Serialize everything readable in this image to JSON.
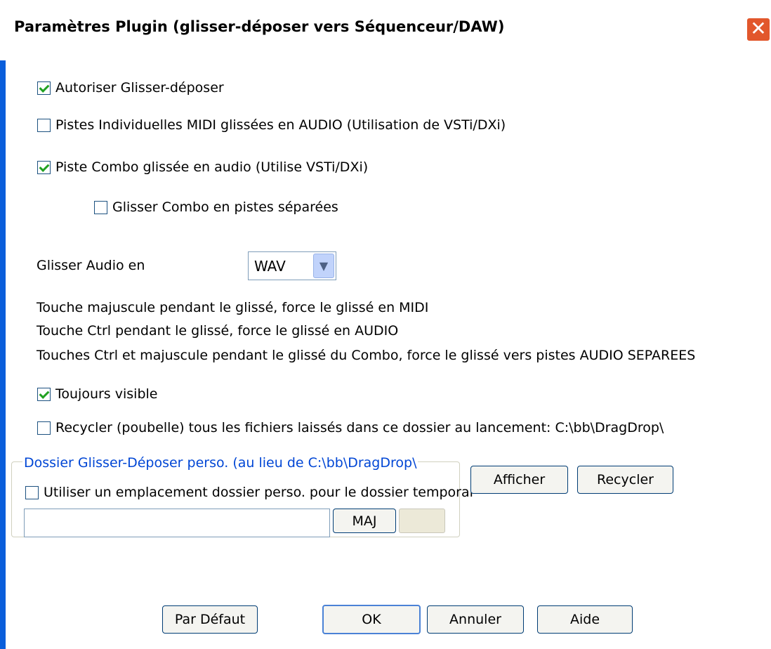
{
  "window": {
    "title": "Paramètres Plugin (glisser-déposer vers Séquenceur/DAW)",
    "close_glyph": "✕"
  },
  "options": {
    "allow_drag": {
      "label": "Autoriser Glisser-déposer",
      "checked": true
    },
    "midi_as_audio": {
      "label": "Pistes Individuelles MIDI glissées en AUDIO (Utilisation de VSTi/DXi)",
      "checked": false
    },
    "combo_as_audio": {
      "label": "Piste Combo glissée en audio (Utilise VSTi/DXi)",
      "checked": true
    },
    "combo_separate": {
      "label": "Glisser Combo en pistes séparées",
      "checked": false
    },
    "always_visible": {
      "label": "Toujours visible",
      "checked": true
    },
    "recycle_on_start": {
      "label": "Recycler (poubelle) tous les fichiers laissés dans ce dossier au lancement: C:\\bb\\DragDrop\\",
      "checked": false
    }
  },
  "audio_format": {
    "label": "Glisser Audio en",
    "value": "WAV"
  },
  "info": [
    "Touche majuscule pendant le glissé, force le glissé en MIDI",
    "Touche Ctrl pendant le glissé, force le glissé en AUDIO",
    "Touches Ctrl et majuscule pendant le glissé du Combo, force le glissé vers pistes AUDIO SEPAREES"
  ],
  "custom_folder": {
    "legend": "Dossier Glisser-Déposer perso. (au lieu de C:\\bb\\DragDrop\\",
    "use_custom": {
      "label": "Utiliser un emplacement dossier perso. pour le dossier temporai",
      "checked": false
    },
    "path_value": "",
    "maj_label": "MAJ"
  },
  "buttons": {
    "afficher": "Afficher",
    "recycler": "Recycler",
    "defaut": "Par Défaut",
    "ok": "OK",
    "annuler": "Annuler",
    "aide": "Aide"
  }
}
